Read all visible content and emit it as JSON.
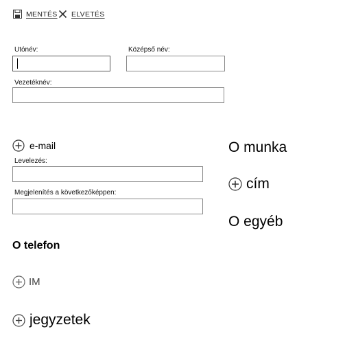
{
  "toolbar": {
    "save_label": "MENTÉS",
    "discard_label": "ELVETÉS",
    "save_icon": "save-disk-icon",
    "discard_icon": "close-icon"
  },
  "name": {
    "first_name_label": "Utónév:",
    "first_name_value": "",
    "middle_name_label": "Középső név:",
    "middle_name_value": "",
    "last_name_label": "Vezetéknév:",
    "last_name_value": ""
  },
  "email": {
    "add_label": "e-mail",
    "mail_label": "Levelezés:",
    "mail_value": "",
    "display_label": "Megjelenítés a következőképpen:",
    "display_value": ""
  },
  "right_column": {
    "work_label": "O munka",
    "address_label": "cím",
    "other_label": "O egyéb"
  },
  "lower": {
    "phone_label": "O telefon",
    "im_label": "IM",
    "notes_label": "jegyzetek"
  },
  "colors": {
    "border": "#8a8a8a",
    "text": "#000000",
    "muted": "#555555"
  }
}
